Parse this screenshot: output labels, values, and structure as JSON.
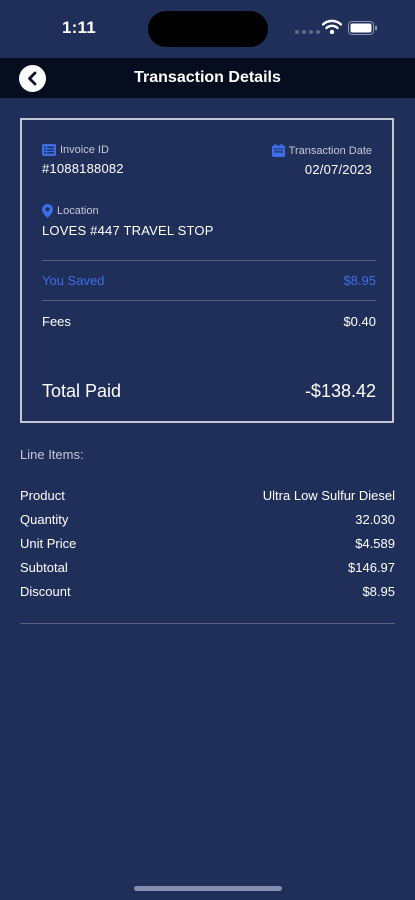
{
  "status_bar": {
    "time": "1:11"
  },
  "header": {
    "title": "Transaction Details",
    "back_icon": "chevron-left-icon"
  },
  "summary": {
    "invoice_label": "Invoice ID",
    "invoice_icon": "list-icon",
    "invoice_value": "#1088188082",
    "date_label": "Transaction Date",
    "date_icon": "calendar-icon",
    "date_value": "02/07/2023",
    "location_label": "Location",
    "location_icon": "map-pin-icon",
    "location_value": "LOVES #447 TRAVEL STOP",
    "saved_label": "You Saved",
    "saved_value": "$8.95",
    "fees_label": "Fees",
    "fees_value": "$0.40",
    "total_label": "Total Paid",
    "total_value": "-$138.42"
  },
  "line_items": {
    "title": "Line Items:",
    "rows": [
      {
        "label": "Product",
        "value": "Ultra Low Sulfur Diesel"
      },
      {
        "label": "Quantity",
        "value": "32.030"
      },
      {
        "label": "Unit Price",
        "value": "$4.589"
      },
      {
        "label": "Subtotal",
        "value": "$146.97"
      },
      {
        "label": "Discount",
        "value": "$8.95"
      }
    ]
  },
  "colors": {
    "background": "#1f2f5a",
    "nav_bar": "#060d1e",
    "accent_blue": "#3c6ee8",
    "card_border": "#c2c7d3"
  }
}
